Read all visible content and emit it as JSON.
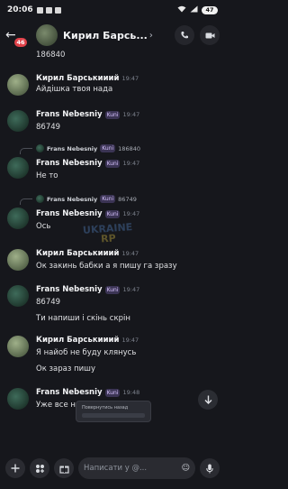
{
  "status_bar": {
    "time": "20:06",
    "battery": "47"
  },
  "header": {
    "title": "Кирил Барсь...",
    "chevron": "›",
    "unread_badge": "46"
  },
  "prev_text": "186840",
  "messages": [
    {
      "author": "Кирил Барськииий",
      "time": "19:47",
      "text": "Айдішка твоя нада"
    },
    {
      "author": "Frans Nebesniy",
      "tag": "Kuni",
      "time": "19:47",
      "text": "86749"
    },
    {
      "reply_author": "Frans Nebesniy",
      "reply_tag": "Kuni",
      "reply_snippet": "186840",
      "author": "Frans Nebesniy",
      "tag": "Kuni",
      "time": "19:47",
      "text": "Не то"
    },
    {
      "reply_author": "Frans Nebesniy",
      "reply_tag": "Kuni",
      "reply_snippet": "86749",
      "author": "Frans Nebesniy",
      "tag": "Kuni",
      "time": "19:47",
      "text": "Ось"
    },
    {
      "author": "Кирил Барськииий",
      "time": "19:47",
      "text": "Ок закинь бабки а я пишу га зразу"
    },
    {
      "author": "Frans Nebesniy",
      "tag": "Kuni",
      "time": "19:47",
      "text": "86749",
      "text2": "Ти напиши і скінь скрін"
    },
    {
      "author": "Кирил Барськииий",
      "time": "19:47",
      "text": "Я найоб не буду клянусь",
      "text2": "Ок зараз пишу"
    },
    {
      "author": "Frans Nebesniy",
      "tag": "Kuni",
      "time": "19:48",
      "text": "Уже все на готові"
    }
  ],
  "watermark": {
    "line1": "UKRAINE",
    "line2": "RP"
  },
  "preview": {
    "label": "Повернутись назад"
  },
  "input": {
    "placeholder": "Написати у @..."
  }
}
